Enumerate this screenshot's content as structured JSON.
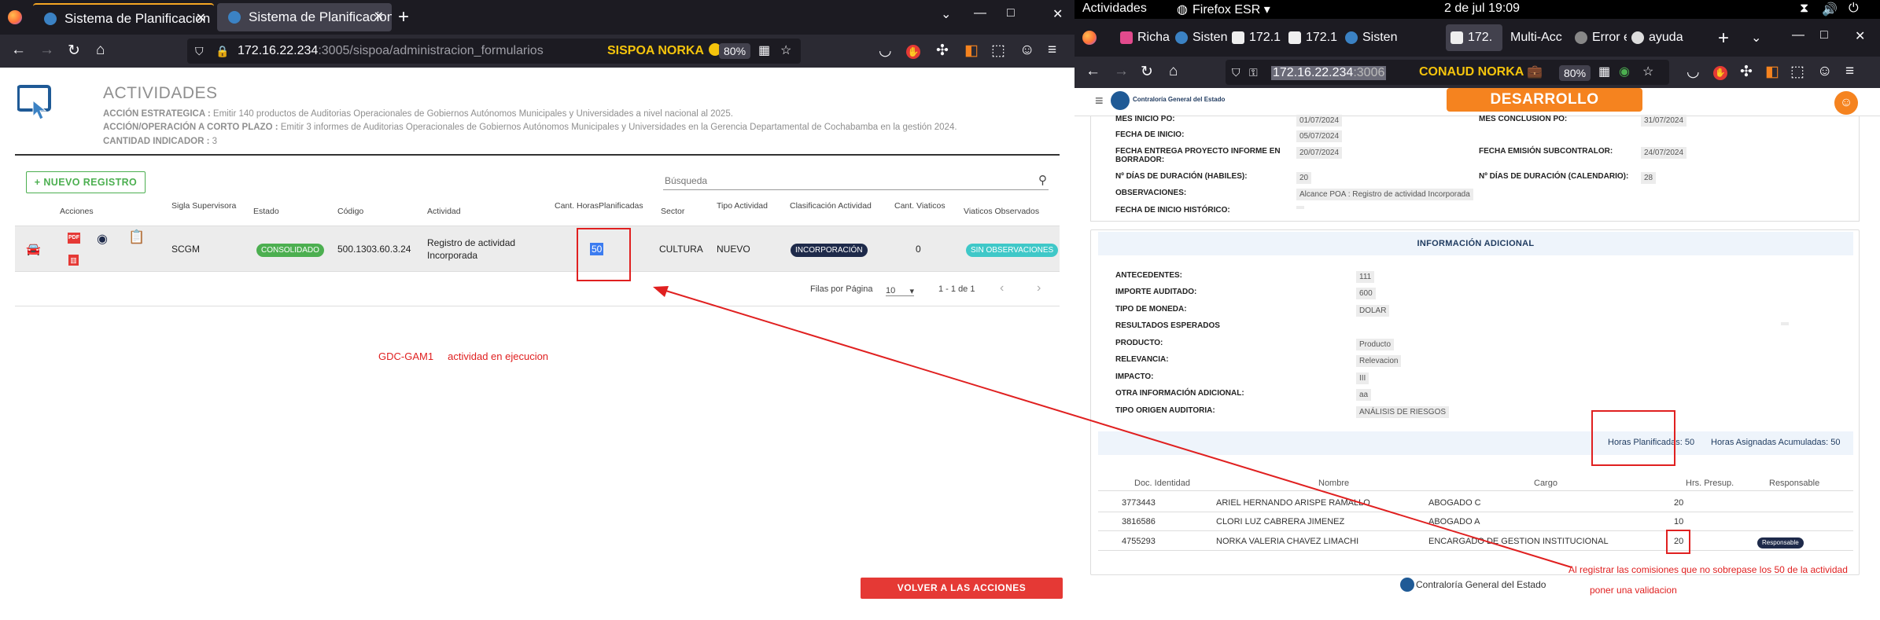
{
  "left_browser": {
    "tabs": [
      {
        "title": "Sistema de Planificacion C",
        "active": false
      },
      {
        "title": "Sistema de Planificacion C",
        "active": true
      }
    ],
    "url_host": "172.16.22.234",
    "url_rest": ":3005/sispoa/administracion_formularios",
    "user_badge": "SISPOA NORKA",
    "zoom": "80%"
  },
  "page": {
    "title": "ACTIVIDADES",
    "meta": [
      {
        "label": "ACCIÓN ESTRATEGICA :",
        "value": " Emitir 140 productos de Auditorias Operacionales de Gobiernos Autónomos Municipales y Universidades a nivel nacional al 2025."
      },
      {
        "label": "ACCIÓN/OPERACIÓN A CORTO PLAZO :",
        "value": " Emitir 3 informes de Auditorias Operacionales de Gobiernos Autónomos Municipales y Universidades en la Gerencia Departamental de Cochabamba en la gestión 2024."
      },
      {
        "label": "CANTIDAD INDICADOR :",
        "value": " 3"
      }
    ],
    "new_button": "NUEVO REGISTRO",
    "search_placeholder": "Búsqueda",
    "columns": {
      "acciones": "Acciones",
      "sigla": "Sigla Supervisora",
      "estado": "Estado",
      "codigo": "Código",
      "actividad": "Actividad",
      "horas": "Cant. HorasPlanificadas",
      "sector": "Sector",
      "tipo": "Tipo Actividad",
      "clasificacion": "Clasificación Actividad",
      "viaticos": "Cant. Viaticos",
      "observados": "Viaticos Observados"
    },
    "row": {
      "sigla": "SCGM",
      "estado": "CONSOLIDADO",
      "codigo": "500.1303.60.3.24",
      "actividad_1": "Registro de actividad",
      "actividad_2": "Incorporada",
      "horas": "50",
      "sector": "CULTURA",
      "tipo": "NUEVO",
      "clasificacion": "INCORPORACIÓN",
      "viaticos": "0",
      "observados": "SIN OBSERVACIONES"
    },
    "pagination": {
      "rows_label": "Filas por Página",
      "rows_value": "10",
      "range": "1 - 1 de 1"
    },
    "note": "GDC-GAM1     actividad en ejecucion",
    "back_button": "VOLVER A LAS ACCIONES ESTRATEGICAS"
  },
  "right_browser": {
    "topbar": {
      "activities": "Actividades",
      "app": "Firefox ESR",
      "clock": "2 de jul  19:09"
    },
    "tabs": [
      "Richa",
      "Sisten",
      "172.1",
      "172.1",
      "Sisten",
      "172.",
      "Multi-Acc",
      "Error e",
      "ayuda"
    ],
    "url_host": "172.16.22.234",
    "url_rest": ":3006",
    "user_badge": "CONAUD NORKA",
    "zoom": "80%",
    "dev_button": "DESARROLLO",
    "org_name": "Contraloría General del Estado"
  },
  "detail": {
    "rows": [
      {
        "label": "MES INICIO PO:",
        "value": "01/07/2024",
        "label2": "MES CONCLUSION PO:",
        "value2": "31/07/2024"
      },
      {
        "label": "FECHA DE INICIO:",
        "value": "05/07/2024"
      },
      {
        "label": "FECHA ENTREGA PROYECTO INFORME EN",
        "label_b": "BORRADOR:",
        "value": "20/07/2024",
        "label2": "FECHA EMISIÓN SUBCONTRALOR:",
        "value2": "24/07/2024"
      },
      {
        "label": "Nº DÍAS DE DURACIÓN (HABILES):",
        "value": "20",
        "label2": "Nº DÍAS DE DURACIÓN (CALENDARIO):",
        "value2": "28"
      },
      {
        "label": "OBSERVACIONES:",
        "value": "Alcance POA : Registro de actividad Incorporada"
      },
      {
        "label": "FECHA DE INICIO HISTÓRICO:",
        "value": ""
      }
    ],
    "info_title": "INFORMACIÓN ADICIONAL",
    "info": [
      {
        "label": "ANTECEDENTES:",
        "value": "111"
      },
      {
        "label": "IMPORTE AUDITADO:",
        "value": "600"
      },
      {
        "label": "TIPO DE MONEDA:",
        "value": "DOLAR"
      },
      {
        "label": "RESULTADOS ESPERADOS",
        "value": ""
      },
      {
        "label": "PRODUCTO:",
        "value": "Producto"
      },
      {
        "label": "RELEVANCIA:",
        "value": "Relevacion"
      },
      {
        "label": "IMPACTO:",
        "value": "III"
      },
      {
        "label": "OTRA INFORMACIÓN ADICIONAL:",
        "value": "aa"
      },
      {
        "label": "TIPO ORIGEN AUDITORIA:",
        "value": "ANÁLISIS DE RIESGOS"
      }
    ],
    "hours_planned": "Horas Planificadas: 50",
    "hours_assigned": "Horas Asignadas Acumuladas: 50",
    "table_headers": [
      "Doc. Identidad",
      "Nombre",
      "Cargo",
      "Hrs. Presup.",
      "Responsable"
    ],
    "table_rows": [
      {
        "doc": "3773443",
        "nombre": "ARIEL HERNANDO ARISPE RAMALLO",
        "cargo": "ABOGADO C",
        "hrs": "20",
        "resp": ""
      },
      {
        "doc": "3816586",
        "nombre": "CLORI LUZ CABRERA JIMENEZ",
        "cargo": "ABOGADO A",
        "hrs": "10",
        "resp": ""
      },
      {
        "doc": "4755293",
        "nombre": "NORKA VALERIA CHAVEZ LIMACHI",
        "cargo": "ENCARGADO DE GESTION INSTITUCIONAL",
        "hrs": "20",
        "resp": "Responsable"
      }
    ],
    "annotation_1": "Al registrar las comisiones que no sobrepase los 50 de la actividad",
    "annotation_2": "poner una validacion"
  },
  "colors": {
    "accent_orange": "#f5831f",
    "annotation_red": "#e02020",
    "success_green": "#4caf50",
    "navy": "#1e2a4a",
    "teal": "#3fc8c8"
  }
}
